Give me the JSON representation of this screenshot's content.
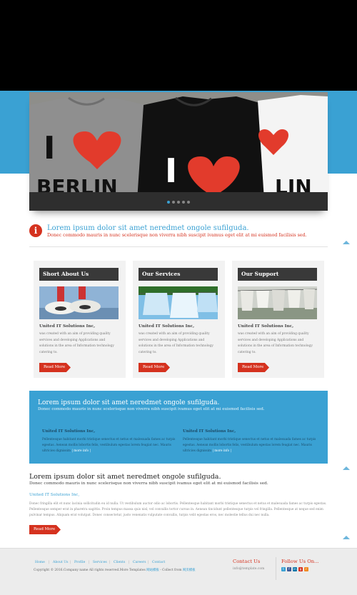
{
  "colors": {
    "brand_blue": "#3aa1d3",
    "accent_red": "#d5321f",
    "dark_header": "#393939"
  },
  "slider": {
    "shirt_left_text": [
      "I",
      "BERLIN"
    ],
    "shirt_middle_text": "I",
    "shirt_right_text": "LIN",
    "dots_count": 5,
    "active_dot": 1
  },
  "info": {
    "icon": "info-icon",
    "title": "Lorem ipsum dolor sit amet neredmet ongole sufilguda.",
    "text": "Donec commodo mauris in nunc scelerisque non viverra nibh suscipit ivamus eget elit at mi euismod facilisis sed."
  },
  "columns": [
    {
      "heading": "Short About Us",
      "title": "United IT Solutions Inc,",
      "text": "was created with an aim of providing quality services and developing Applications and solutions in the area of Information technology catering to.",
      "button": "Read More"
    },
    {
      "heading": "Our Services",
      "title": "United IT Solutions Inc,",
      "text": "was created with an aim of providing quality services and developing Applications and solutions in the area of Information technology catering to.",
      "button": "Read More"
    },
    {
      "heading": "Our Support",
      "title": "United IT Solutions Inc,",
      "text": "was created with an aim of providing quality services and developing Applications and solutions in the area of Information technology catering to.",
      "button": "Read More"
    }
  ],
  "blue_box": {
    "title": "Lorem ipsum dolor sit amet neredmet ongole sufilguda.",
    "text": "Donec commodo mauris in nunc scelerisque non viverra nibh suscipit ivamus eget elit at mi euismod facilisis sed.",
    "left": {
      "title": "United IT Solutions Inc,",
      "text": "Pellentesque habitant morbi tristique senectus et netus et malesuada fames ac turpis egestas. Aenean mollis lobortis felis, vestibulum egestas lorem feugiat nec. Mauris ultricies dignissim",
      "more": "| more info |"
    },
    "right": {
      "title": "United IT Solutions Inc,",
      "text": "Pellentesque habitant morbi tristique senectus et netus et malesuada fames ac turpis egestas. Aenean mollis lobortis felis, vestibulum egestas lorem feugiat nec. Mauris ultricies dignissim",
      "more": "| more info |"
    }
  },
  "cta": {
    "title": "Lorem ipsum dolor sit amet neredmet ongole sufilguda.",
    "subtitle": "Donec commodo mauris in nunc scelerisque non viverra nibh suscipit ivamus eget elit at mi euismod facilisis sed.",
    "company": "United IT Solutions Inc,",
    "paragraph": "Donec fringilla elit et nunc lacinia sollicitudin eu id nulla. Ut vestibulum auctor odio ac lobortis. Pellentesque habitant morbi tristique senectus et netus et malesuada fames ac turpis egestas. Pellentesque semper erat in pharetra sagittis. Proin tempus massa quis nisl, vel convallis tortor cursus in. Aenean tincidunt pellentesque turpis vel fringilla. Pellentesque at neque sed enim pulvinar tempus. Aliquam erat volutpat. Donec consectetur, justo venenatis vulputate convallis, turpis velit egestas eros, nec molestie tellus dui nec nulla.",
    "button": "Read More"
  },
  "footer": {
    "nav": [
      "Home",
      "About Us",
      "Profile",
      "Services",
      "Clients",
      "Careers",
      "Contact"
    ],
    "copyright_prefix": "Copyright © 2016.Company name All rights reserved.More Templates",
    "copyright_link1": "网站模板",
    "copyright_mid": "- Collect from",
    "copyright_link2": "网页模板",
    "contact_title": "Contact Us",
    "contact_email": "info@template.com",
    "follow_title": "Follow Us On...",
    "social": [
      {
        "icon": "twitter-icon",
        "glyph": "t",
        "color": "#3aa1d3"
      },
      {
        "icon": "facebook-icon",
        "glyph": "f",
        "color": "#3b5998"
      },
      {
        "icon": "linkedin-icon",
        "glyph": "in",
        "color": "#0e76a8"
      },
      {
        "icon": "googleplus-icon",
        "glyph": "g",
        "color": "#d5321f"
      },
      {
        "icon": "rss-icon",
        "glyph": "r",
        "color": "#f08a24"
      }
    ]
  }
}
